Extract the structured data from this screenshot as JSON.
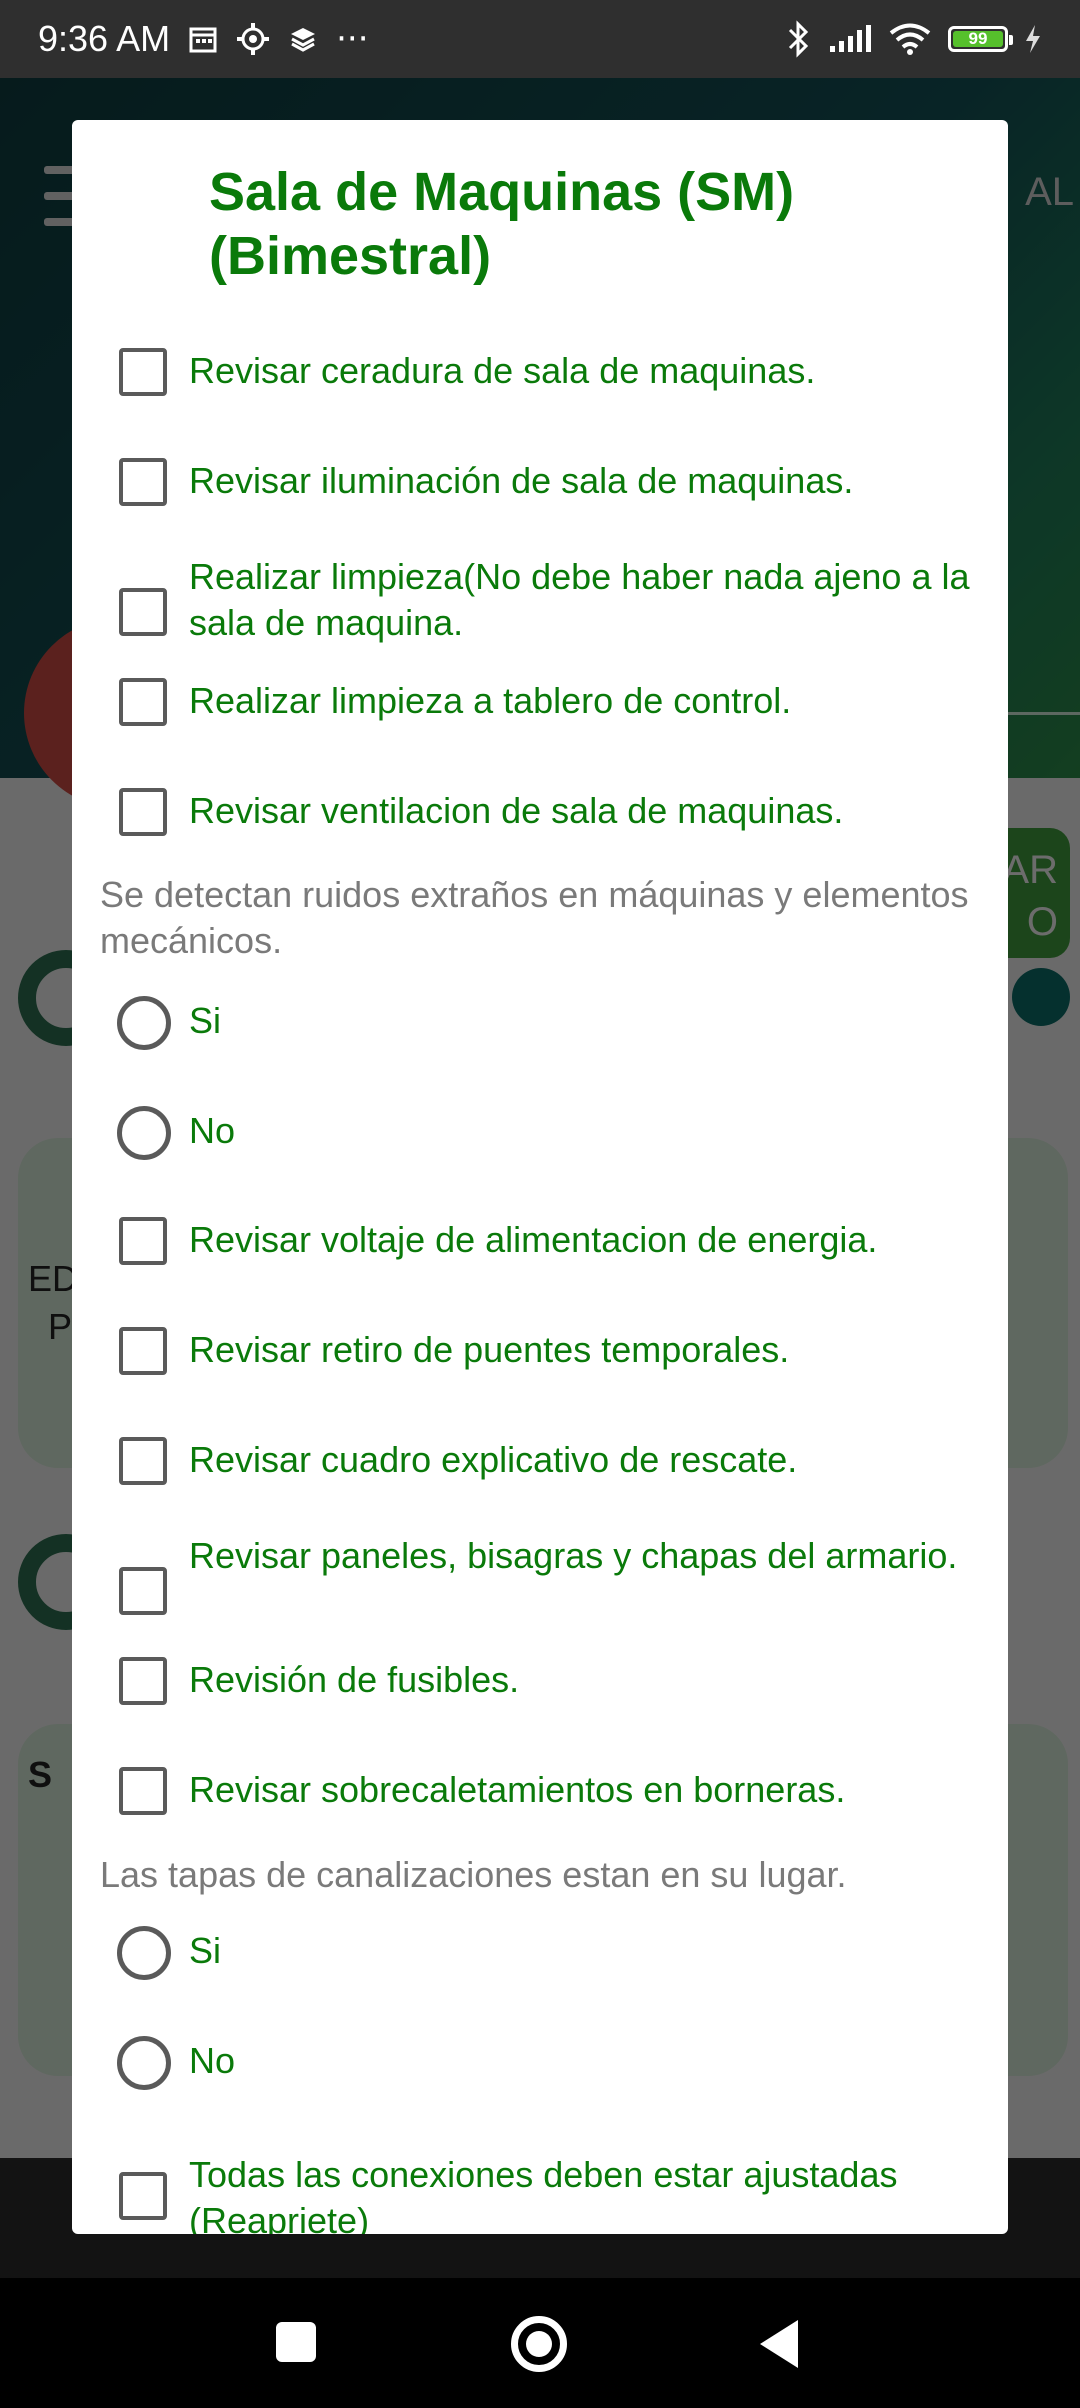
{
  "status_bar": {
    "time": "9:36 AM",
    "more": "···",
    "battery": "99"
  },
  "background_app": {
    "logo_fragment": "AL",
    "button_fragment_1": "AR",
    "button_fragment_2": "O",
    "card1_fragment_1": "ED",
    "card1_fragment_2": "P",
    "card2_fragment": "S"
  },
  "dialog": {
    "title": "Sala de Maquinas (SM) (Bimestral)",
    "items": [
      {
        "type": "checkbox",
        "label": "Revisar ceradura de sala de maquinas."
      },
      {
        "type": "checkbox",
        "label": "Revisar iluminación de sala de maquinas."
      },
      {
        "type": "checkbox",
        "label": "Realizar limpieza(No debe haber nada ajeno a la sala de maquina."
      },
      {
        "type": "checkbox",
        "label": "Realizar limpieza a tablero de control."
      },
      {
        "type": "checkbox",
        "label": "Revisar ventilacion de sala de maquinas."
      },
      {
        "type": "question",
        "label": "Se detectan ruidos extraños en máquinas y elementos mecánicos."
      },
      {
        "type": "radio",
        "label": "Si"
      },
      {
        "type": "radio",
        "label": "No"
      },
      {
        "type": "checkbox",
        "label": "Revisar voltaje de alimentacion de energia."
      },
      {
        "type": "checkbox",
        "label": "Revisar retiro de puentes temporales."
      },
      {
        "type": "checkbox",
        "label": "Revisar cuadro explicativo de rescate."
      },
      {
        "type": "checkbox",
        "label": "Revisar paneles, bisagras y chapas del armario."
      },
      {
        "type": "checkbox",
        "label": "Revisión de fusibles."
      },
      {
        "type": "checkbox",
        "label": "Revisar sobrecaletamientos en borneras."
      },
      {
        "type": "question",
        "label": "Las tapas de canalizaciones estan en su lugar."
      },
      {
        "type": "radio",
        "label": "Si"
      },
      {
        "type": "radio",
        "label": "No"
      },
      {
        "type": "checkbox",
        "label": "Todas las conexiones deben estar ajustadas (Reapriete)"
      }
    ]
  }
}
